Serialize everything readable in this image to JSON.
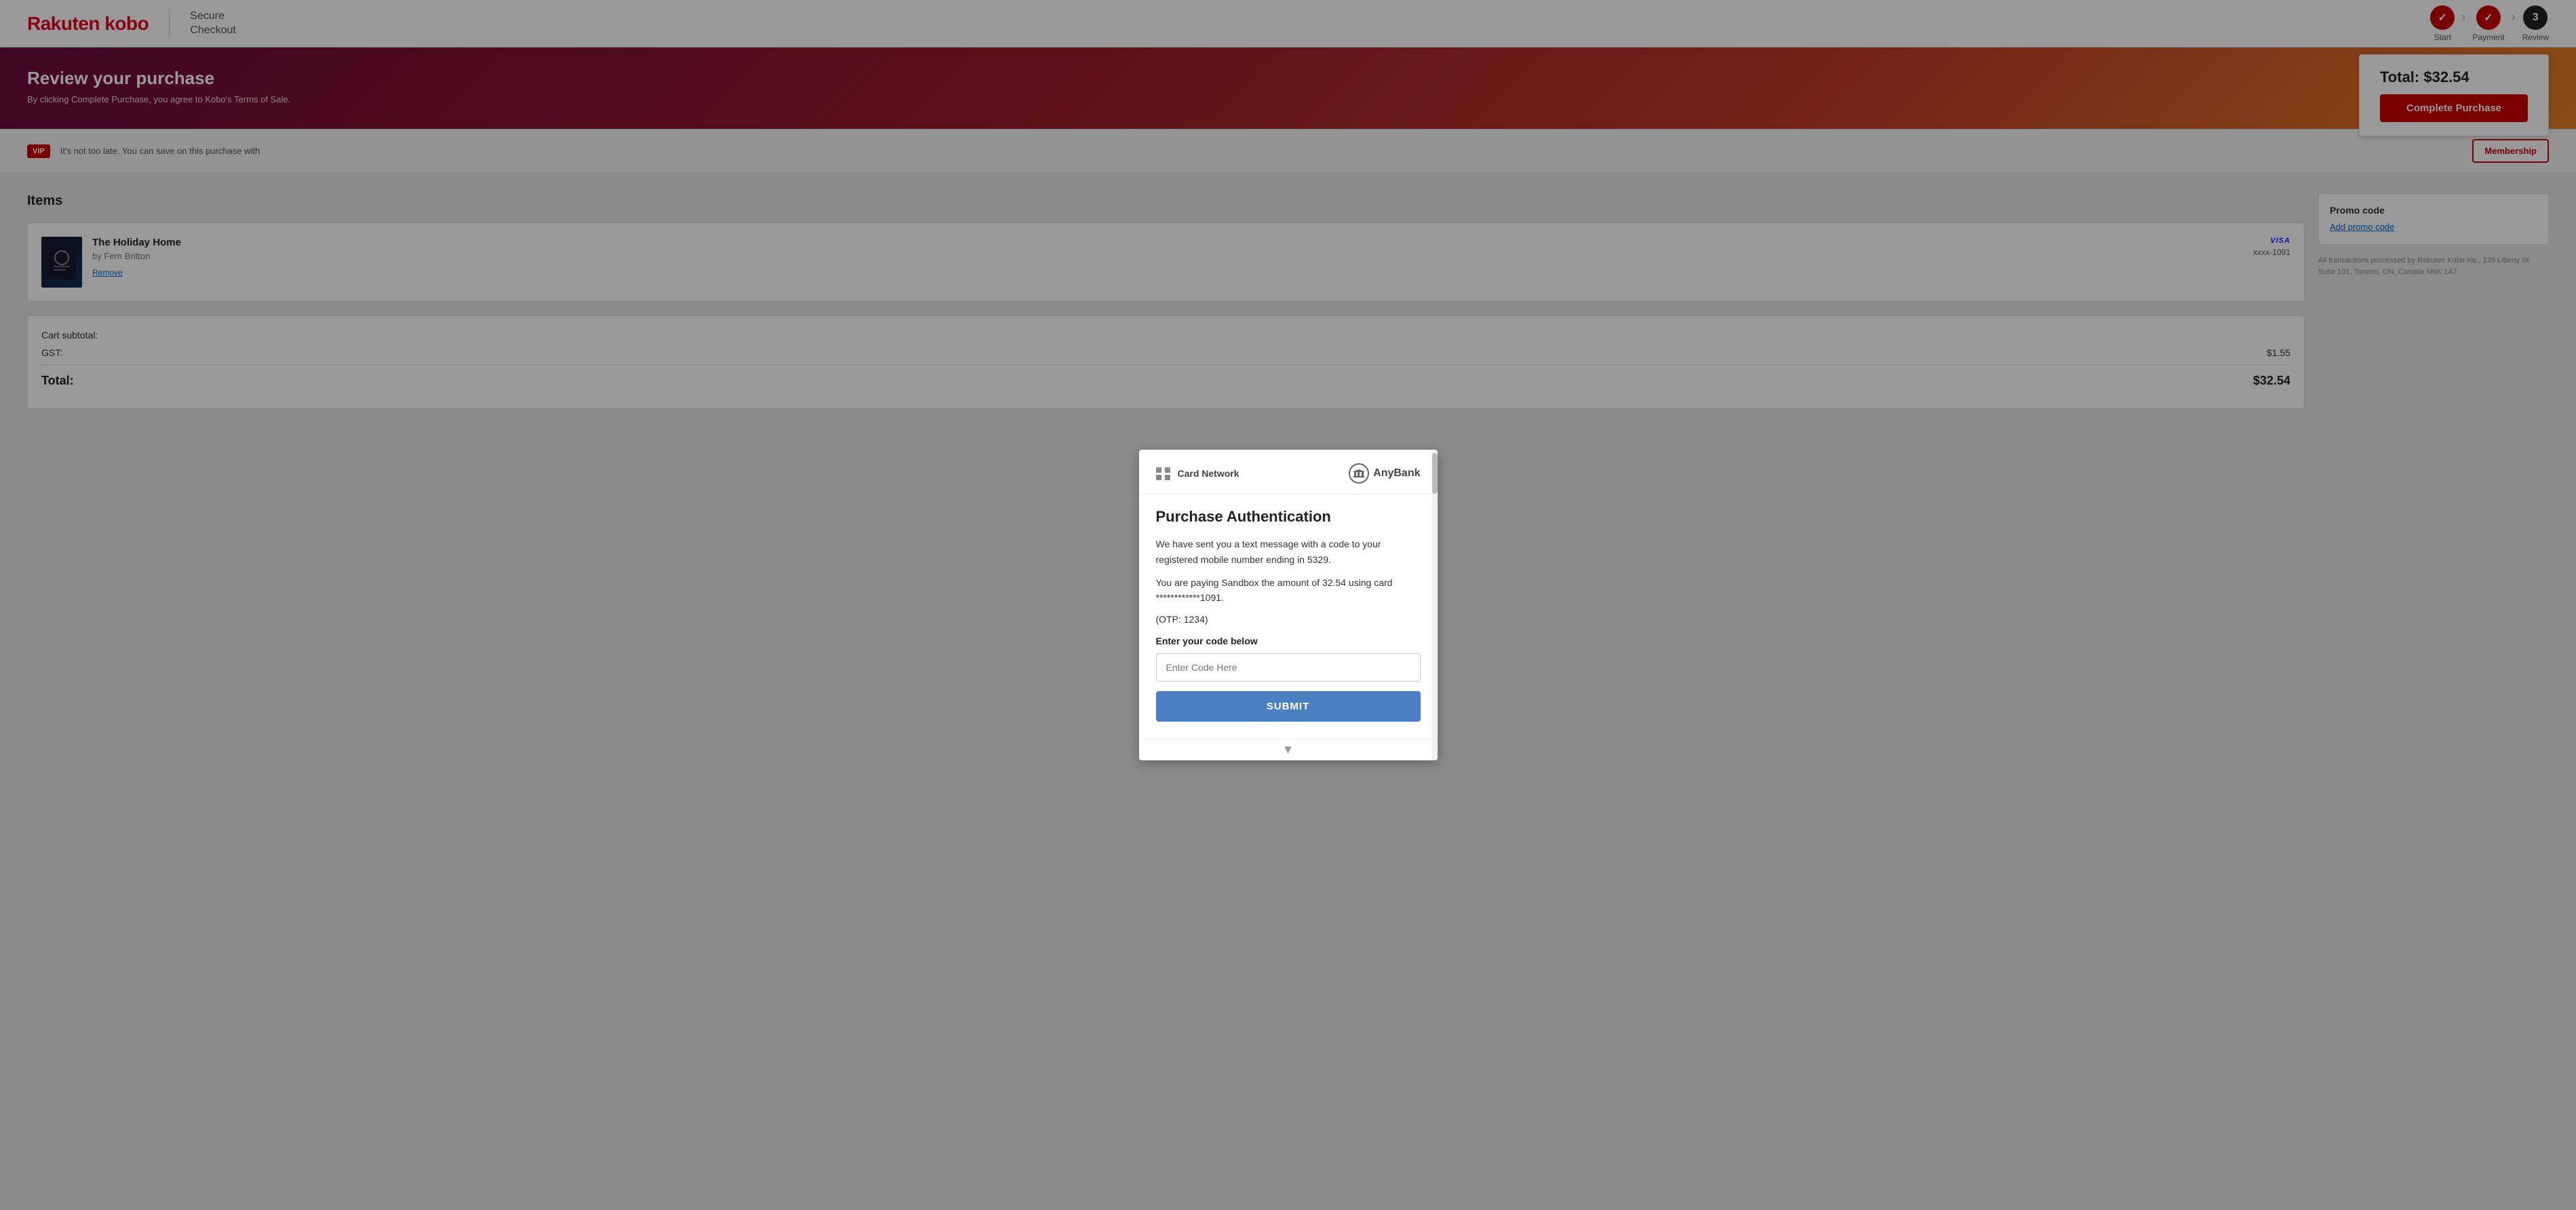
{
  "header": {
    "logo": "Rakuten kobo",
    "secure_checkout": "Secure\nCheckout",
    "steps": [
      {
        "label": "Start",
        "state": "done",
        "number": "✓"
      },
      {
        "label": "Payment",
        "state": "done",
        "number": "✓"
      },
      {
        "label": "Review",
        "state": "current",
        "number": "3"
      }
    ]
  },
  "hero": {
    "title": "Review your purchase",
    "subtitle": "By clicking Complete Purchase, you agree to Kobo's Terms of Sale."
  },
  "total_card": {
    "label": "Total: $32.54",
    "button": "Complete Purchase"
  },
  "vip": {
    "badge": "VIP",
    "text": "It's not too late. You can save on this purchase with",
    "button": "Membership"
  },
  "items_section": {
    "title": "Items",
    "item": {
      "title": "The Holiday Home",
      "author": "by Fern Britton",
      "remove_label": "Remove",
      "visa_label": "VISA",
      "card_last4": "xxxx-1091"
    }
  },
  "totals": {
    "subtotal_label": "Cart subtotal:",
    "subtotal_value": "",
    "gst_label": "GST:",
    "gst_value": "$1.55",
    "total_label": "Total:",
    "total_value": "$32.54"
  },
  "promo": {
    "title": "Promo code",
    "link": "Add promo code"
  },
  "legal": {
    "text": "All transactions processed by Rakuten Kobo Inc., 135 Liberty St. Suite 101, Toronto, ON, Canada M6K 1A7"
  },
  "modal": {
    "card_network_label": "Card Network",
    "anybank_label": "AnyBank",
    "title": "Purchase Authentication",
    "message1": "We have sent you a text message with a code to your registered mobile number ending in 5329.",
    "message2": "You are paying Sandbox the amount of 32.54 using card ************1091.",
    "otp": "(OTP: 1234)",
    "code_label": "Enter your code below",
    "input_placeholder": "Enter Code Here",
    "submit_label": "SUBMIT"
  }
}
